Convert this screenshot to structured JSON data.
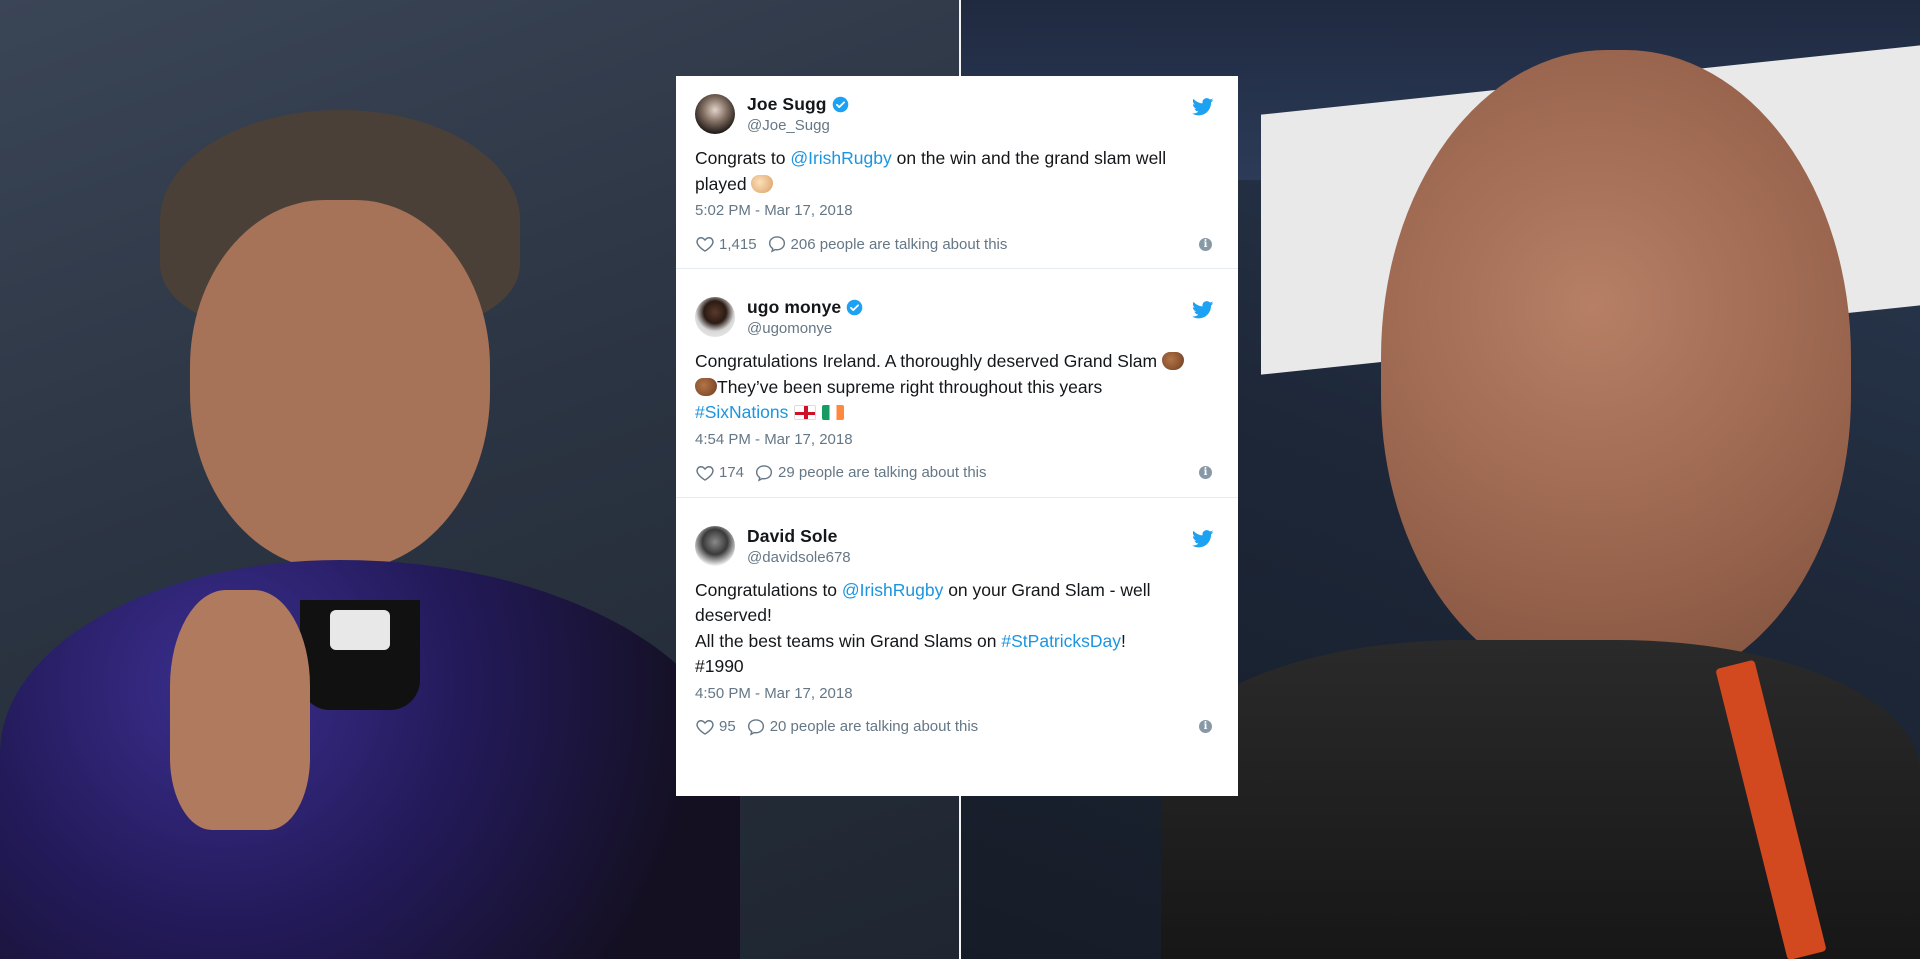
{
  "tweets": [
    {
      "name": "Joe Sugg",
      "handle": "@Joe_Sugg",
      "verified": true,
      "text_pre": "Congrats to ",
      "mention": "@IrishRugby",
      "text_post": " on the win and the grand slam well played",
      "timestamp": "5:02 PM - Mar 17, 2018",
      "likes": "1,415",
      "talking": "206 people are talking about this"
    },
    {
      "name": "ugo monye",
      "handle": "@ugomonye",
      "verified": true,
      "line1": "Congratulations Ireland. A thoroughly deserved Grand Slam",
      "line2": "They’ve been supreme right throughout this years",
      "hashtag": "#SixNations",
      "timestamp": "4:54 PM - Mar 17, 2018",
      "likes": "174",
      "talking": "29 people are talking about this"
    },
    {
      "name": "David Sole",
      "handle": "@davidsole678",
      "verified": false,
      "line1_pre": "Congratulations to ",
      "mention": "@IrishRugby",
      "line1_post": " on your Grand Slam - well deserved!",
      "line2_pre": "All the best teams win Grand Slams on ",
      "hashtag": "#StPatricksDay",
      "line2_post": "!",
      "line3": "#1990",
      "timestamp": "4:50 PM - Mar 17, 2018",
      "likes": "95",
      "talking": "20 people are talking about this"
    }
  ],
  "colors": {
    "link": "#1b95e0",
    "secondary_text": "#657786",
    "primary_text": "#14171a",
    "twitter_blue": "#1da1f2"
  },
  "icons": [
    "verified-badge-icon",
    "twitter-bird-icon",
    "heart-icon",
    "reply-bubble-icon",
    "info-icon",
    "clapping-hands-emoji",
    "england-flag-emoji",
    "ireland-flag-emoji"
  ]
}
